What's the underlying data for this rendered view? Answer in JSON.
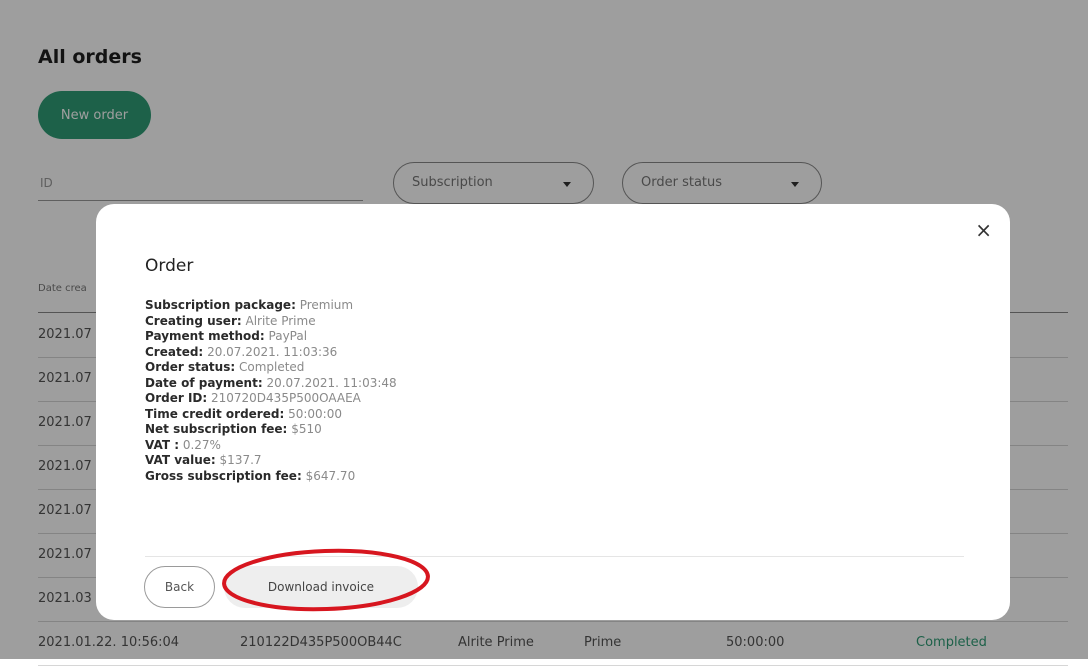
{
  "page": {
    "title": "All orders",
    "new_order_label": "New order"
  },
  "filters": {
    "id_placeholder": "ID",
    "subscription_label": "Subscription",
    "order_status_label": "Order status"
  },
  "table": {
    "date_header": "Date crea",
    "rows": [
      {
        "date": "2021.07",
        "id": "",
        "user": "",
        "subscription": "",
        "time": "",
        "status": ""
      },
      {
        "date": "2021.07",
        "id": "",
        "user": "",
        "subscription": "",
        "time": "",
        "status": ""
      },
      {
        "date": "2021.07",
        "id": "",
        "user": "",
        "subscription": "",
        "time": "",
        "status": ""
      },
      {
        "date": "2021.07",
        "id": "",
        "user": "",
        "subscription": "",
        "time": "",
        "status": ""
      },
      {
        "date": "2021.07",
        "id": "",
        "user": "",
        "subscription": "",
        "time": "",
        "status": ""
      },
      {
        "date": "2021.07",
        "id": "",
        "user": "",
        "subscription": "",
        "time": "",
        "status": ""
      },
      {
        "date": "2021.03",
        "id": "",
        "user": "",
        "subscription": "",
        "time": "",
        "status": ""
      },
      {
        "date": "2021.01.22. 10:56:04",
        "id": "210122D435P500OB44C",
        "user": "Alrite Prime",
        "subscription": "Prime",
        "time": "50:00:00",
        "status": "Completed"
      }
    ]
  },
  "modal": {
    "title": "Order",
    "close_symbol": "×",
    "details": [
      {
        "label": "Subscription package:",
        "value": "Premium"
      },
      {
        "label": "Creating user:",
        "value": "Alrite Prime"
      },
      {
        "label": "Payment method:",
        "value": "PayPal"
      },
      {
        "label": "Created:",
        "value": "20.07.2021. 11:03:36"
      },
      {
        "label": "Order status:",
        "value": "Completed"
      },
      {
        "label": "Date of payment:",
        "value": "20.07.2021. 11:03:48"
      },
      {
        "label": "Order ID:",
        "value": "210720D435P500OAAEA"
      },
      {
        "label": "Time credit ordered:",
        "value": "50:00:00"
      },
      {
        "label": "Net subscription fee:",
        "value": "$510"
      },
      {
        "label": "VAT :",
        "value": "0.27%"
      },
      {
        "label": "VAT value:",
        "value": "$137.7"
      },
      {
        "label": "Gross subscription fee:",
        "value": "$647.70"
      }
    ],
    "back_label": "Back",
    "download_label": "Download invoice"
  },
  "colors": {
    "accent": "#2f9d76",
    "annotation": "#d7161f",
    "overlay": "rgba(0,0,0,0.38)"
  }
}
